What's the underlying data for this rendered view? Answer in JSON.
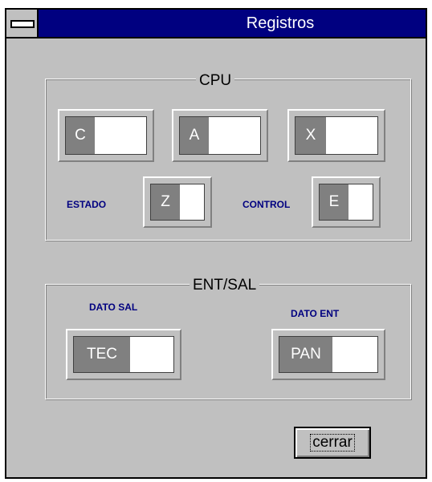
{
  "window": {
    "title": "Registros"
  },
  "cpu": {
    "legend": "CPU",
    "registers": {
      "c": "C",
      "a": "A",
      "x": "X",
      "z": "Z",
      "e": "E"
    },
    "labels": {
      "estado": "ESTADO",
      "control": "CONTROL"
    }
  },
  "io": {
    "legend": "ENT/SAL",
    "labels": {
      "dato_sal": "DATO SAL",
      "dato_ent": "DATO ENT"
    },
    "registers": {
      "tec": "TEC",
      "pan": "PAN"
    }
  },
  "buttons": {
    "close": "cerrar"
  },
  "colors": {
    "title_bar": "#000080",
    "window_bg": "#c0c0c0",
    "label_text": "#000080",
    "register_label_bg": "#808080"
  }
}
